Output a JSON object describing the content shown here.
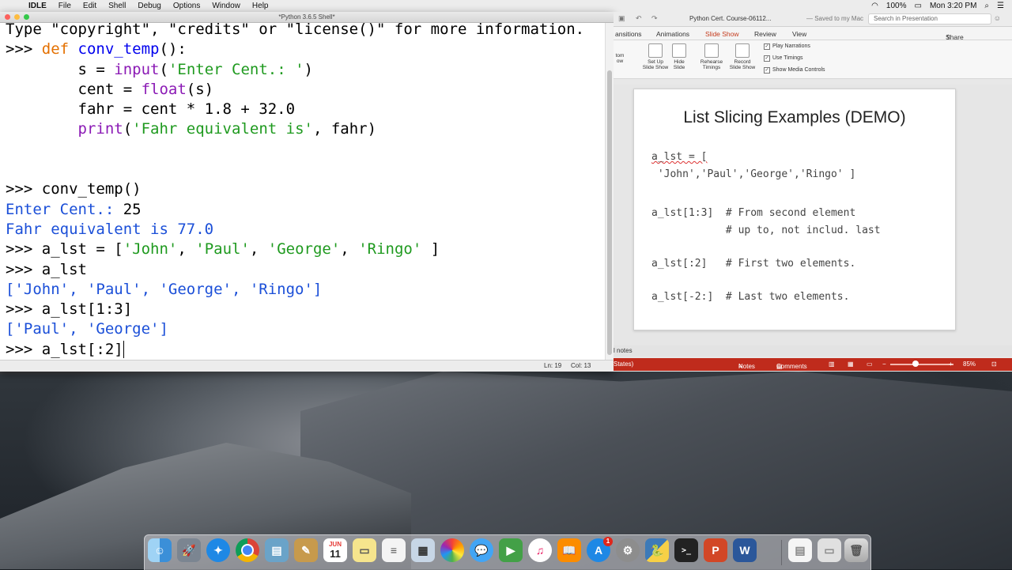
{
  "menubar": {
    "app": "IDLE",
    "items": [
      "File",
      "Edit",
      "Shell",
      "Debug",
      "Options",
      "Window",
      "Help"
    ],
    "battery": "100%",
    "clock": "Mon 3:20 PM"
  },
  "idle": {
    "title": "*Python 3.6.5 Shell*",
    "status_ln": "Ln: 19",
    "status_col": "Col: 13",
    "lines": {
      "l1": "Type \"copyright\", \"credits\" or \"license()\" for more information.",
      "prompt": ">>> ",
      "def_kw": "def",
      "def_name": "conv_temp",
      "def_tail": "():",
      "l3a": "        s = ",
      "l3b": "input",
      "l3c": "(",
      "l3s": "'Enter Cent.: '",
      "l3d": ")",
      "l4a": "        cent = ",
      "l4b": "float",
      "l4c": "(s)",
      "l5": "        fahr = cent * 1.8 + 32.0",
      "l6a": "        ",
      "l6b": "print",
      "l6c": "(",
      "l6s": "'Fahr equivalent is'",
      "l6d": ", fahr)",
      "l9": "conv_temp()",
      "l10": "Enter Cent.: ",
      "l10v": "25",
      "l11": "Fahr equivalent is 77.0",
      "l12a": "a_lst = [",
      "l12s1": "'John'",
      "l12s2": "'Paul'",
      "l12s3": "'George'",
      "l12s4": "'Ringo'",
      "l12z": " ]",
      "l13": "a_lst",
      "l14": "['John', 'Paul', 'George', 'Ringo']",
      "l15": "a_lst[1:3]",
      "l16": "['Paul', 'George']",
      "l17": "a_lst[:2]"
    }
  },
  "ppt": {
    "doc_title": "Python Cert. Course-06112...",
    "saved": "— Saved to my Mac",
    "search_placeholder": "Search in Presentation",
    "tabs": [
      "ansitions",
      "Animations",
      "Slide Show",
      "Review",
      "View"
    ],
    "share": "Share",
    "ribbon": {
      "b1": "tom\now",
      "b2": "Set Up\nSlide Show",
      "b3": "Hide\nSlide",
      "b4": "Rehearse\nTimings",
      "b5": "Record\nSlide Show",
      "chk1": "Play Narrations",
      "chk2": "Use Timings",
      "chk3": "Show Media Controls"
    },
    "slide": {
      "title": "List Slicing Examples (DEMO)",
      "l1": "a_lst = [",
      "l2": " 'John','Paul','George','Ringo' ]",
      "l3": "a_lst[1:3]  # From second element",
      "l4": "            # up to, not includ. last",
      "l5": "a_lst[:2]   # First two elements.",
      "l6": "a_lst[-2:]  # Last two elements."
    },
    "notes": "l notes",
    "statusbar": {
      "left": "States)",
      "notes": "Notes",
      "comments": "Comments",
      "zoom": "85%"
    }
  },
  "dock": {
    "items": [
      "Finder",
      "Launchpad",
      "Safari",
      "Chrome",
      "Preview",
      "Notes",
      "Calendar",
      "Stickies",
      "TextEdit",
      "Mail",
      "Photos",
      "Messages",
      "FaceTime",
      "iTunes",
      "iBooks",
      "App Store",
      "System Preferences",
      "Python",
      "Terminal",
      "PowerPoint",
      "Word",
      "Document",
      "Screenshot",
      "Trash"
    ],
    "calendar_day": "11",
    "calendar_month": "JUN",
    "appstore_badge": "1"
  }
}
